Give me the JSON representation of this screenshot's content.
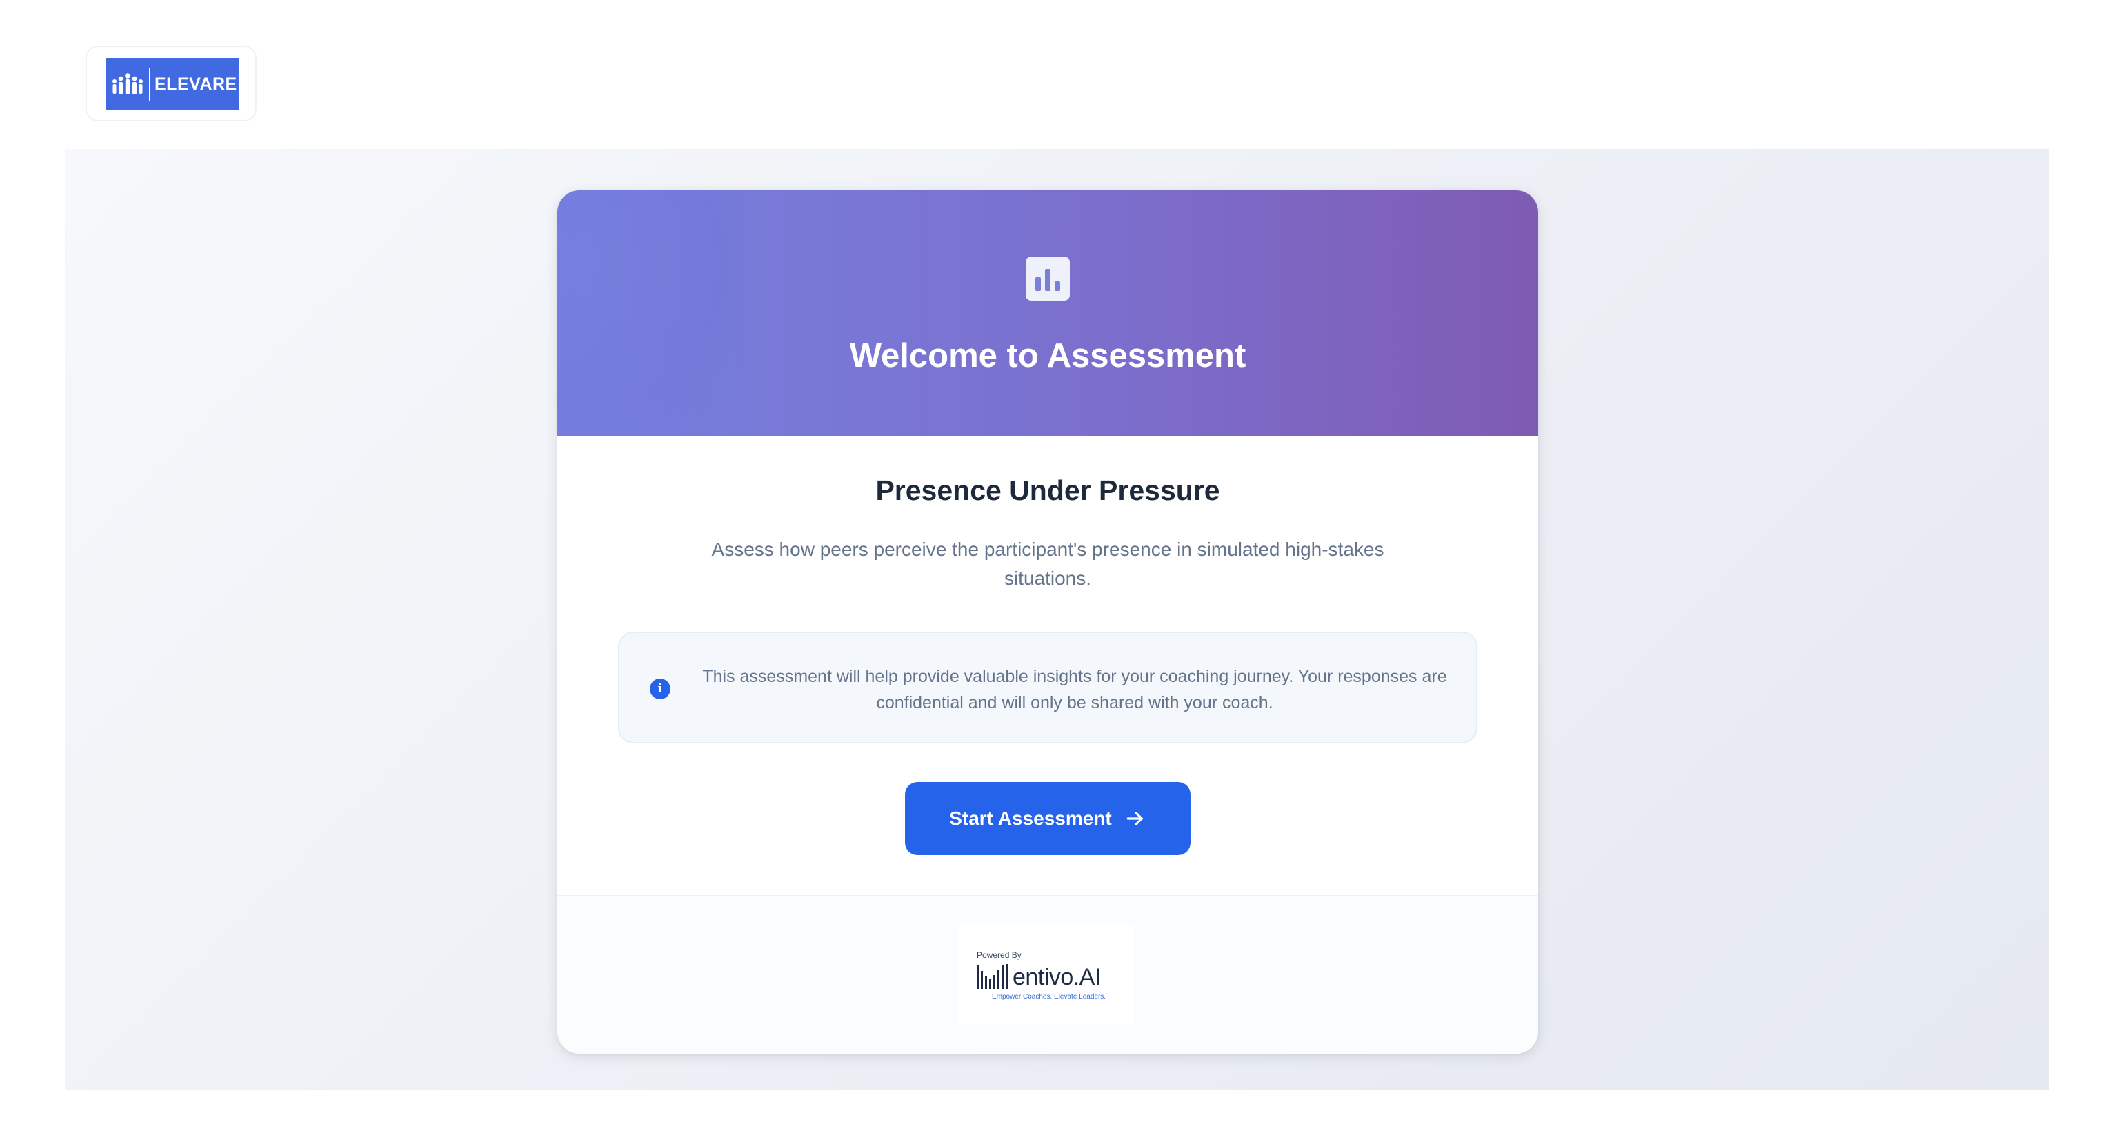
{
  "brand": {
    "logo_text": "ELEVARE",
    "colors": {
      "logo_bg": "#4169e1",
      "primary": "#2563eb",
      "hero_start": "#7680df",
      "hero_end": "#7f5bb3"
    }
  },
  "hero": {
    "icon": "bar-chart-icon",
    "title": "Welcome to Assessment"
  },
  "assessment": {
    "name": "Presence Under Pressure",
    "description": "Assess how peers perceive the participant's presence in simulated high-stakes situations."
  },
  "info": {
    "icon": "info-icon",
    "icon_glyph": "i",
    "text": "This assessment will help provide valuable insights for your coaching journey. Your responses are confidential and will only be shared with your coach."
  },
  "actions": {
    "start_label": "Start Assessment",
    "start_icon": "arrow-right-icon"
  },
  "footer": {
    "powered_by": "Powered By",
    "product": "entivo.AI",
    "tagline": "Empower Coaches. Elevate Leaders."
  }
}
